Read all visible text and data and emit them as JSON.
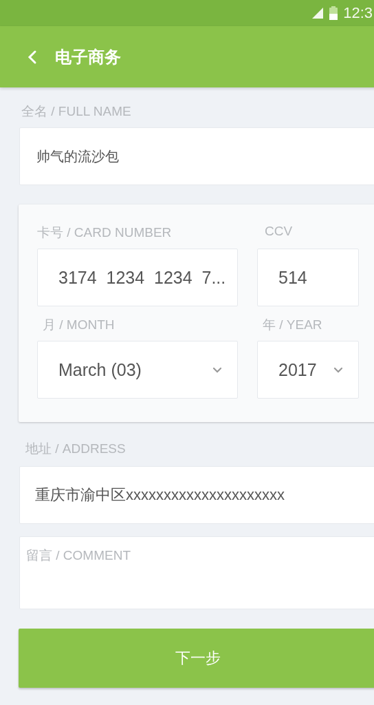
{
  "status_bar": {
    "time": "12:3"
  },
  "app_bar": {
    "title": "电子商务"
  },
  "full_name": {
    "label": "全名 / FULL NAME",
    "value": "帅气的流沙包"
  },
  "card": {
    "number_label": "卡号 / CARD NUMBER",
    "number_value": "3174  1234  1234  7...",
    "ccv_label": "CCV",
    "ccv_value": "514",
    "month_label": "月 / MONTH",
    "month_value": "March (03)",
    "year_label": "年 / YEAR",
    "year_value": "2017"
  },
  "address": {
    "label": "地址 / ADDRESS",
    "value": "重庆市渝中区xxxxxxxxxxxxxxxxxxxxx"
  },
  "comment": {
    "placeholder": "留言 / COMMENT"
  },
  "next_button": {
    "label": "下一步"
  }
}
